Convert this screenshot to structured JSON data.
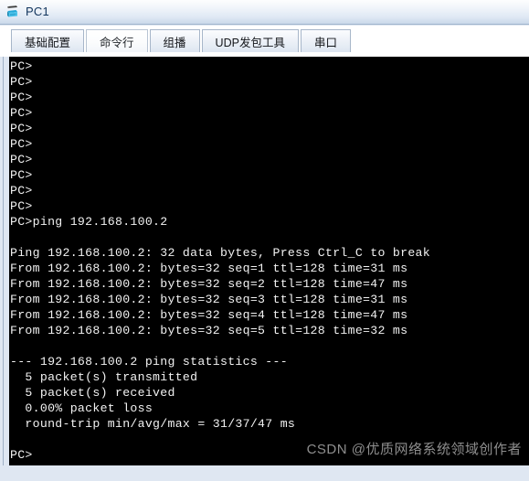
{
  "window": {
    "title": "PC1",
    "icon": "pc-device-icon"
  },
  "tabs": [
    {
      "label": "基础配置",
      "active": false,
      "name": "tab-basic-config"
    },
    {
      "label": "命令行",
      "active": true,
      "name": "tab-command-line"
    },
    {
      "label": "组播",
      "active": false,
      "name": "tab-multicast"
    },
    {
      "label": "UDP发包工具",
      "active": false,
      "name": "tab-udp-packet-tool"
    },
    {
      "label": "串口",
      "active": false,
      "name": "tab-serial-port"
    }
  ],
  "terminal": {
    "prompt": "PC>",
    "command": "ping 192.168.100.2",
    "target_ip": "192.168.100.2",
    "lines": [
      "PC>",
      "PC>",
      "PC>",
      "PC>",
      "PC>",
      "PC>",
      "PC>",
      "PC>",
      "PC>",
      "PC>",
      "PC>ping 192.168.100.2",
      "",
      "Ping 192.168.100.2: 32 data bytes, Press Ctrl_C to break",
      "From 192.168.100.2: bytes=32 seq=1 ttl=128 time=31 ms",
      "From 192.168.100.2: bytes=32 seq=2 ttl=128 time=47 ms",
      "From 192.168.100.2: bytes=32 seq=3 ttl=128 time=31 ms",
      "From 192.168.100.2: bytes=32 seq=4 ttl=128 time=47 ms",
      "From 192.168.100.2: bytes=32 seq=5 ttl=128 time=32 ms",
      "",
      "--- 192.168.100.2 ping statistics ---",
      "  5 packet(s) transmitted",
      "  5 packet(s) received",
      "  0.00% packet loss",
      "  round-trip min/avg/max = 31/37/47 ms",
      "",
      "PC>"
    ],
    "replies": [
      {
        "from": "192.168.100.2",
        "bytes": 32,
        "seq": 1,
        "ttl": 128,
        "time_ms": 31
      },
      {
        "from": "192.168.100.2",
        "bytes": 32,
        "seq": 2,
        "ttl": 128,
        "time_ms": 47
      },
      {
        "from": "192.168.100.2",
        "bytes": 32,
        "seq": 3,
        "ttl": 128,
        "time_ms": 31
      },
      {
        "from": "192.168.100.2",
        "bytes": 32,
        "seq": 4,
        "ttl": 128,
        "time_ms": 47
      },
      {
        "from": "192.168.100.2",
        "bytes": 32,
        "seq": 5,
        "ttl": 128,
        "time_ms": 32
      }
    ],
    "statistics": {
      "header": "--- 192.168.100.2 ping statistics ---",
      "transmitted": "  5 packet(s) transmitted",
      "received": "  5 packet(s) received",
      "loss": "  0.00% packet loss",
      "round_trip": "  round-trip min/avg/max = 31/37/47 ms"
    },
    "colors": {
      "background": "#000000",
      "text": "#f2f2f2"
    }
  },
  "watermark": {
    "text": "CSDN @优质网络系统领域创作者"
  }
}
